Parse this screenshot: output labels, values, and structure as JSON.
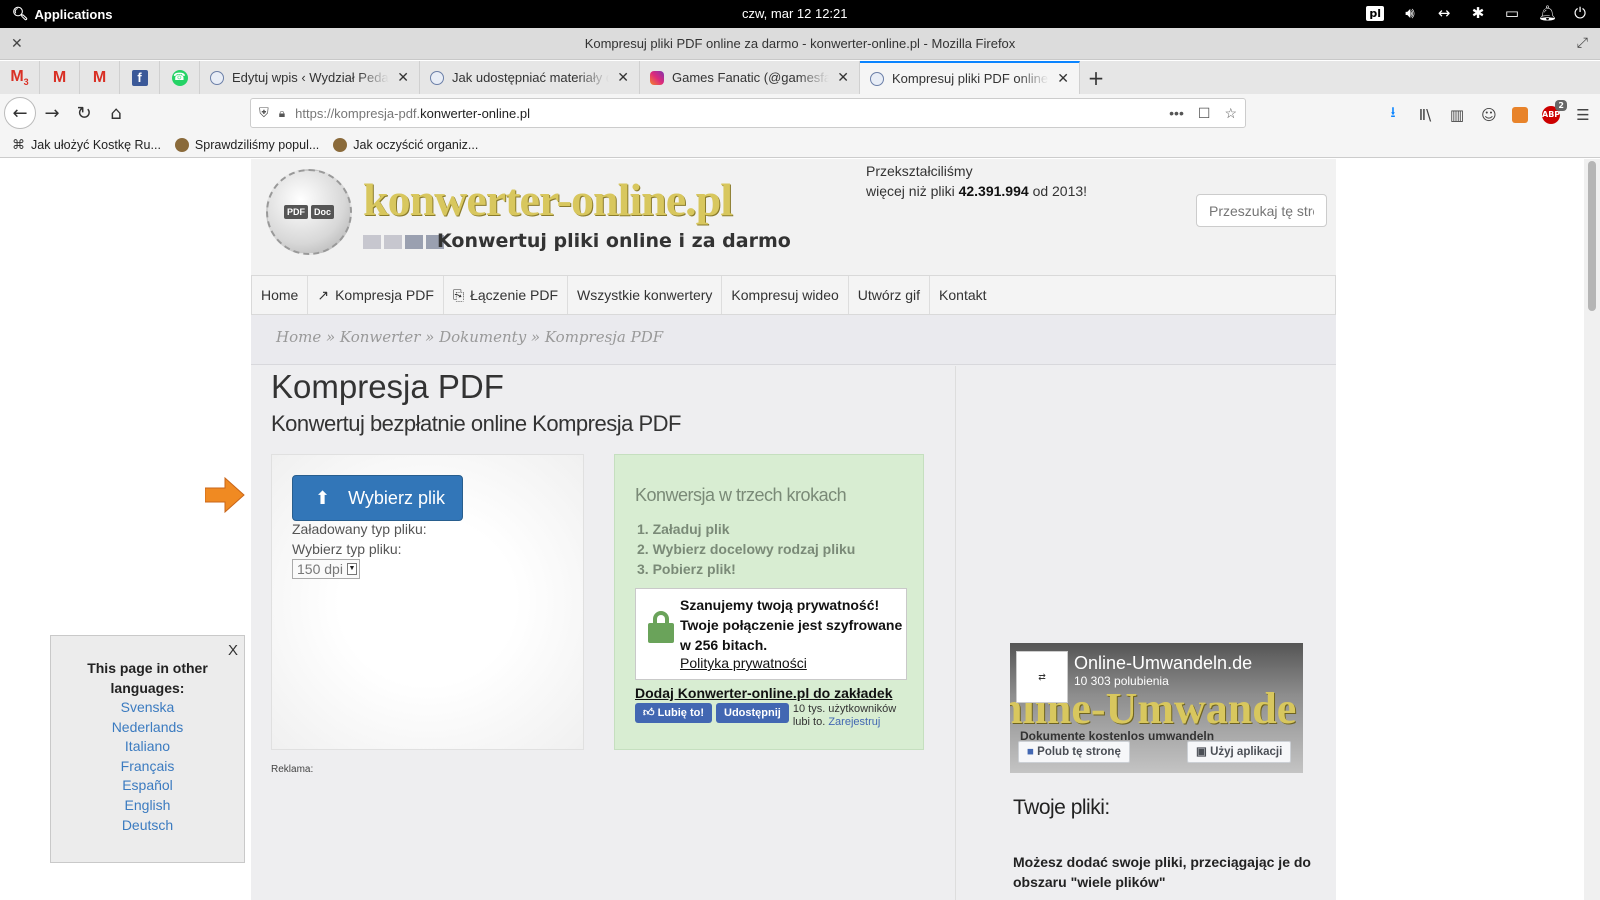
{
  "os": {
    "applications_label": "Applications",
    "clock": "czw, mar 12     12:21",
    "keyboard_layout": "pl"
  },
  "browser": {
    "window_title": "Kompresuj pliki PDF online za darmo - konwerter-online.pl - Mozilla Firefox",
    "pinned_tabs": [
      {
        "icon": "gmail-icon",
        "badge": "3"
      },
      {
        "icon": "gmail-icon"
      },
      {
        "icon": "gmail-icon"
      },
      {
        "icon": "facebook-icon"
      },
      {
        "icon": "whatsapp-icon"
      }
    ],
    "tabs": [
      {
        "title": "Edytuj wpis ‹ Wydział Pedagogiki"
      },
      {
        "title": "Jak udostępniać materiały dla"
      },
      {
        "title": "Games Fanatic (@gamesfanatic"
      },
      {
        "title": "Kompresuj pliki PDF online za darmo",
        "active": true
      }
    ],
    "url_prefix": "https://kompresja-pdf.",
    "url_domain": "konwerter-online.pl",
    "abp_badge": "2",
    "bookmarks": [
      {
        "label": "Jak ułożyć Kostkę Ru..."
      },
      {
        "label": "Sprawdziliśmy popul..."
      },
      {
        "label": "Jak oczyścić organiz..."
      }
    ]
  },
  "site": {
    "logo_name": "konwerter-online.pl",
    "logo_tagline": "Konwertuj pliki online i za darmo",
    "logo_badge_left": "PDF",
    "logo_badge_right": "Doc",
    "stats_line1": "Przekształciliśmy",
    "stats_line2_pre": "więcej niż pliki",
    "stats_count": "42.391.994",
    "stats_line2_post": "od 2013!",
    "search_placeholder": "Przeszukaj tę stronę",
    "menu": [
      {
        "label": "Home"
      },
      {
        "label": "Kompresja PDF",
        "icon": "compress-icon"
      },
      {
        "label": "Łączenie PDF",
        "icon": "merge-icon"
      },
      {
        "label": "Wszystkie konwertery"
      },
      {
        "label": "Kompresuj wideo"
      },
      {
        "label": "Utwórz gif"
      },
      {
        "label": "Kontakt"
      }
    ],
    "breadcrumb": "Home » Konwerter » Dokumenty » Kompresja PDF",
    "title": "Kompresja PDF",
    "subtitle": "Konwertuj bezpłatnie online Kompresja PDF",
    "upload": {
      "button": "Wybierz plik",
      "loaded_type_label": "Załadowany typ pliku:",
      "choose_type_label": "Wybierz typ pliku:",
      "dpi_value": "150 dpi"
    },
    "steps": {
      "title": "Konwersja w trzech krokach",
      "items": [
        "1. Załaduj plik",
        "2. Wybierz docelowy rodzaj pliku",
        "3. Pobierz plik!"
      ],
      "privacy_text": "Szanujemy twoją prywatność! Twoje połączenie jest szyfrowane w 256 bitach.",
      "privacy_link": "Polityka prywatności",
      "bookmark_link": "Dodaj Konwerter-online.pl do zakładek",
      "fb_like": "Lubię to!",
      "fb_share": "Udostępnij",
      "fb_count_text": "10 tys. użytkowników lubi to.",
      "fb_register": "Zarejestruj"
    },
    "ad_label": "Reklama:",
    "fb_page": {
      "name": "Online-Umwandeln.de",
      "likes": "10 303 polubienia",
      "banner": "nline-Umwande",
      "banner_tagline": "Dokumente kostenlos umwandeln",
      "like_page": "Polub tę stronę",
      "use_app": "Użyj aplikacji"
    },
    "files": {
      "title": "Twoje pliki:",
      "text": "Możesz dodać swoje pliki, przeciągając je do obszaru \"wiele plików\""
    },
    "languages": {
      "close": "X",
      "title": "This page in other languages:",
      "items": [
        "Svenska",
        "Nederlands",
        "Italiano",
        "Français",
        "Español",
        "English",
        "Deutsch"
      ]
    }
  }
}
